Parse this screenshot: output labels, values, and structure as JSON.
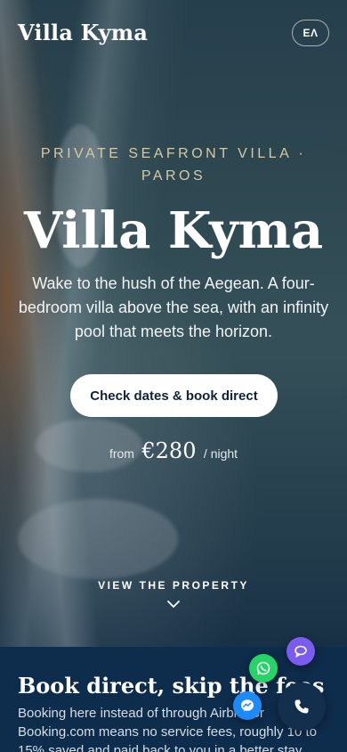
{
  "header": {
    "brand": "Villa Kyma",
    "language_button": "ΕΛ"
  },
  "hero": {
    "eyebrow": "PRIVATE SEAFRONT VILLA · PAROS",
    "title": "Villa Kyma",
    "subtitle": "Wake to the hush of the Aegean. A four-bedroom villa above the sea, with an infinity pool that meets the horizon.",
    "cta_label": "Check dates & book direct",
    "price_from": "from",
    "price_amount": "€280",
    "price_unit": "/ night",
    "view_link": "VIEW THE PROPERTY"
  },
  "section": {
    "title": "Book direct, skip the fees",
    "body": "Booking here instead of through Airbnb or Booking.com means no service fees, roughly 10 to 15% saved and paid back to you in a better stay."
  },
  "contact_buttons": {
    "chat_icon": "chat-bubble-icon",
    "whatsapp_icon": "whatsapp-icon",
    "messenger_icon": "messenger-icon",
    "call_icon": "phone-icon"
  },
  "colors": {
    "accent_gold": "#d6c9a3",
    "navy": "#0e2c4b",
    "chat": "#7a5cf0",
    "whatsapp": "#25d366",
    "messenger": "#1d8bf7"
  }
}
